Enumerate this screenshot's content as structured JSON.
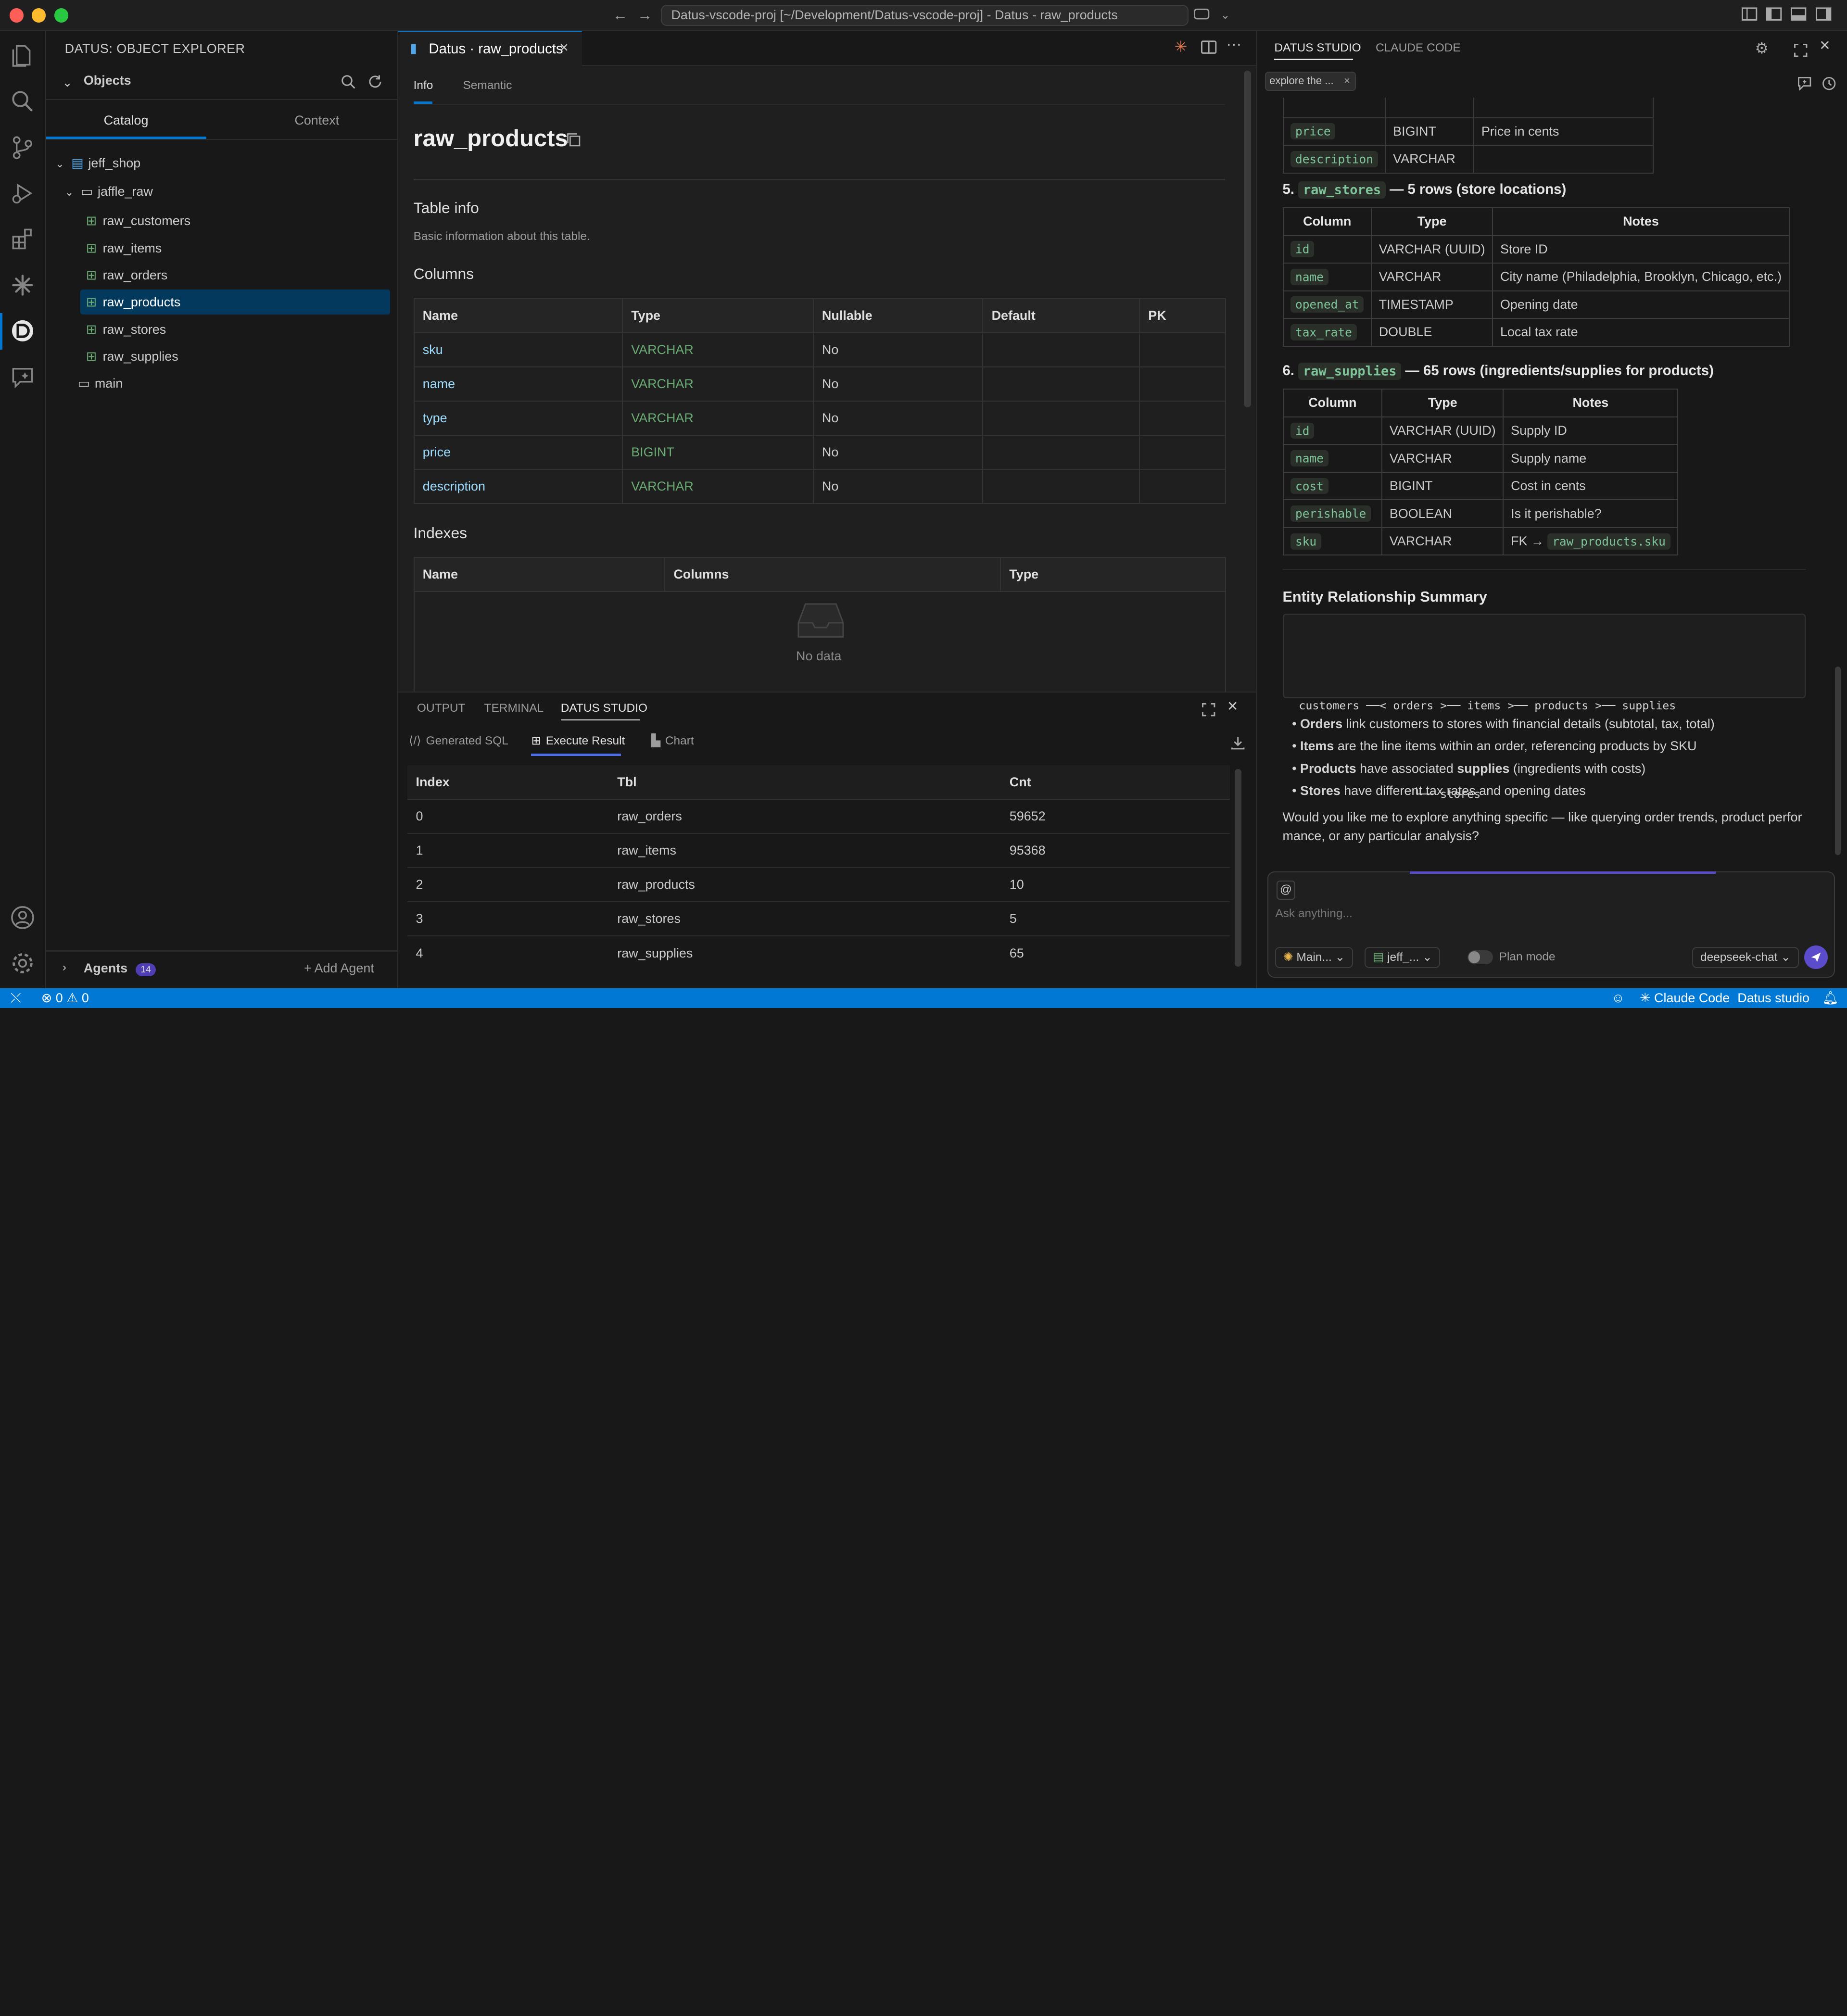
{
  "window": {
    "title": "Datus-vscode-proj [~/Development/Datus-vscode-proj] - Datus - raw_products"
  },
  "sidebar": {
    "title": "DATUS: OBJECT EXPLORER",
    "section": "Objects",
    "tabs": [
      "Catalog",
      "Context"
    ],
    "tree": {
      "database": "jeff_shop",
      "schema": "jaffle_raw",
      "tables": [
        "raw_customers",
        "raw_items",
        "raw_orders",
        "raw_products",
        "raw_stores",
        "raw_supplies"
      ],
      "other_schema": "main"
    },
    "agents": {
      "label": "Agents",
      "count": "14",
      "add_label": "+ Add Agent"
    }
  },
  "editor": {
    "tab_label": "Datus · raw_products",
    "subtabs": [
      "Info",
      "Semantic"
    ],
    "table_name": "raw_products",
    "table_info_heading": "Table info",
    "table_info_desc": "Basic information about this table.",
    "columns_heading": "Columns",
    "columns_headers": [
      "Name",
      "Type",
      "Nullable",
      "Default",
      "PK"
    ],
    "columns": [
      {
        "name": "sku",
        "type": "VARCHAR",
        "nullable": "No"
      },
      {
        "name": "name",
        "type": "VARCHAR",
        "nullable": "No"
      },
      {
        "name": "type",
        "type": "VARCHAR",
        "nullable": "No"
      },
      {
        "name": "price",
        "type": "BIGINT",
        "nullable": "No"
      },
      {
        "name": "description",
        "type": "VARCHAR",
        "nullable": "No"
      }
    ],
    "indexes_heading": "Indexes",
    "indexes_headers": [
      "Name",
      "Columns",
      "Type"
    ],
    "no_data": "No data"
  },
  "panel": {
    "tabs": [
      "OUTPUT",
      "TERMINAL",
      "DATUS STUDIO"
    ],
    "subtabs": [
      "Generated SQL",
      "Execute Result",
      "Chart"
    ],
    "headers": [
      "Index",
      "Tbl",
      "Cnt"
    ],
    "rows": [
      [
        "0",
        "raw_orders",
        "59652"
      ],
      [
        "1",
        "raw_items",
        "95368"
      ],
      [
        "2",
        "raw_products",
        "10"
      ],
      [
        "3",
        "raw_stores",
        "5"
      ],
      [
        "4",
        "raw_supplies",
        "65"
      ]
    ]
  },
  "chat": {
    "tabs": [
      "DATUS STUDIO",
      "CLAUDE CODE"
    ],
    "session_chip": "explore the ...",
    "prev_table_rows": [
      [
        "price",
        "BIGINT",
        "Price in cents"
      ],
      [
        "description",
        "VARCHAR",
        ""
      ]
    ],
    "section5": {
      "num": "5.",
      "name": "raw_stores",
      "desc": "— 5 rows (store locations)"
    },
    "stores_headers": [
      "Column",
      "Type",
      "Notes"
    ],
    "stores_rows": [
      [
        "id",
        "VARCHAR (UUID)",
        "Store ID"
      ],
      [
        "name",
        "VARCHAR",
        "City name (Philadelphia, Brooklyn, Chicago, etc.)"
      ],
      [
        "opened_at",
        "TIMESTAMP",
        "Opening date"
      ],
      [
        "tax_rate",
        "DOUBLE",
        "Local tax rate"
      ]
    ],
    "section6": {
      "num": "6.",
      "name": "raw_supplies",
      "desc": "— 65 rows (ingredients/supplies for products)"
    },
    "supplies_headers": [
      "Column",
      "Type",
      "Notes"
    ],
    "supplies_rows": [
      [
        "id",
        "VARCHAR (UUID)",
        "Supply ID"
      ],
      [
        "name",
        "VARCHAR",
        "Supply name"
      ],
      [
        "cost",
        "BIGINT",
        "Cost in cents"
      ],
      [
        "perishable",
        "BOOLEAN",
        "Is it perishable?"
      ]
    ],
    "supplies_last": {
      "col": "sku",
      "type": "VARCHAR",
      "fk": "FK →",
      "ref": "raw_products.sku"
    },
    "er_heading": "Entity Relationship Summary",
    "er_line1": "customers ──< orders >── items >── products >── supplies",
    "er_line2": "                 └── stores",
    "bullets": [
      {
        "bold": "Orders",
        "text": " link customers to stores with financial details (subtotal, tax, total)"
      },
      {
        "bold": "Items",
        "text": " are the line items within an order, referencing products by SKU"
      },
      {
        "bold": "Products",
        "text": " have associated ",
        "bold2": "supplies",
        "text2": " (ingredients with costs)"
      },
      {
        "bold": "Stores",
        "text": " have different tax rates and opening dates"
      }
    ],
    "closing": "Would you like me to explore anything specific — like querying order trends, product performance, or any particular analysis?",
    "input_placeholder": "Ask anything...",
    "agent_select": "Main...",
    "db_select": "jeff_...",
    "plan_mode": "Plan mode",
    "model_select": "deepseek-chat"
  },
  "statusbar": {
    "errors": "0",
    "warnings": "0",
    "claude": "Claude Code",
    "studio": "Datus studio"
  }
}
